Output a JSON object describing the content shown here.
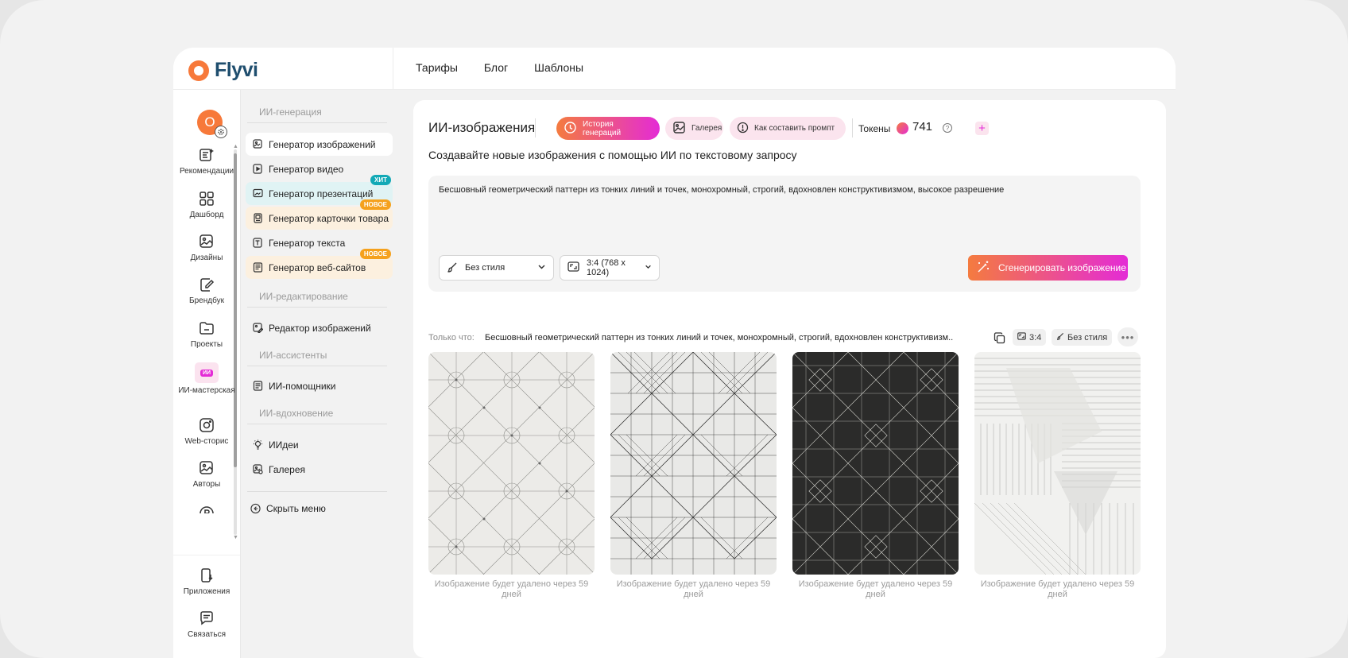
{
  "app": {
    "name": "Flyvi",
    "user_initial": "O"
  },
  "topnav": [
    "Тарифы",
    "Блог",
    "Шаблоны"
  ],
  "rail": [
    {
      "label": "Рекомендации",
      "icon": "recommendations-icon"
    },
    {
      "label": "Дашборд",
      "icon": "dashboard-icon"
    },
    {
      "label": "Дизайны",
      "icon": "designs-icon"
    },
    {
      "label": "Брендбук",
      "icon": "brandbook-icon"
    },
    {
      "label": "Проекты",
      "icon": "folder-icon"
    },
    {
      "label": "ИИ-мастерская",
      "icon": "ai-workshop-icon"
    },
    {
      "label": "Web-сторис",
      "icon": "web-stories-icon"
    },
    {
      "label": "Авторы",
      "icon": "authors-icon"
    },
    {
      "label": "Приложения",
      "icon": "apps-icon"
    },
    {
      "label": "Связаться",
      "icon": "contact-icon"
    }
  ],
  "menu": {
    "sections": [
      "ИИ-генерация",
      "ИИ-редактирование",
      "ИИ-ассистенты",
      "ИИ-вдохновение"
    ],
    "items": [
      {
        "label": "Генератор изображений"
      },
      {
        "label": "Генератор видео"
      },
      {
        "label": "Генератор презентаций",
        "badge": "ХИТ"
      },
      {
        "label": "Генератор карточки товара",
        "badge": "НОВОЕ"
      },
      {
        "label": "Генератор текста"
      },
      {
        "label": "Генератор веб-сайтов",
        "badge": "НОВОЕ"
      },
      {
        "label": "Редактор изображений"
      },
      {
        "label": "ИИ-помощники"
      },
      {
        "label": "ИИдеи"
      },
      {
        "label": "Галерея"
      }
    ],
    "hide_label": "Скрыть меню",
    "ai_badge": "ИИ"
  },
  "main": {
    "title": "ИИ-изображения",
    "pills": {
      "history": "История генераций",
      "gallery": "Галерея",
      "prompt_help": "Как составить промпт"
    },
    "tokens_label": "Токены",
    "tokens_value": "741",
    "help_glyph": "?",
    "plus_glyph": "+",
    "subtitle": "Создавайте новые изображения с помощью ИИ по текстовому запросу",
    "prompt": "Бесшовный геометрический паттерн из тонких линий и точек, монохромный, строгий, вдохновлен конструктивизмом, высокое разрешение",
    "style_select": "Без стиля",
    "ratio_select": "3:4 (768 x 1024)",
    "generate_button": "Сгенерировать изображение",
    "just_now_label": "Только что:",
    "just_now_prompt": "Бесшовный геометрический паттерн из тонких линий и точек, монохромный, строгий, вдохновлен конструктивизм...",
    "chip_ratio": "3:4",
    "chip_style": "Без стиля",
    "more_glyph": "•••",
    "captions": [
      "Изображение будет удалено через 59 дней",
      "Изображение будет удалено через 59 дней",
      "Изображение будет удалено через 59 дней",
      "Изображение будет удалено через 59 дней"
    ]
  },
  "colors": {
    "accent_orange": "#f47b3f",
    "accent_magenta": "#e42bd6",
    "logo_dark": "#1f4e6e",
    "hit_badge": "#12a9b6",
    "new_badge": "#f5a11d"
  }
}
